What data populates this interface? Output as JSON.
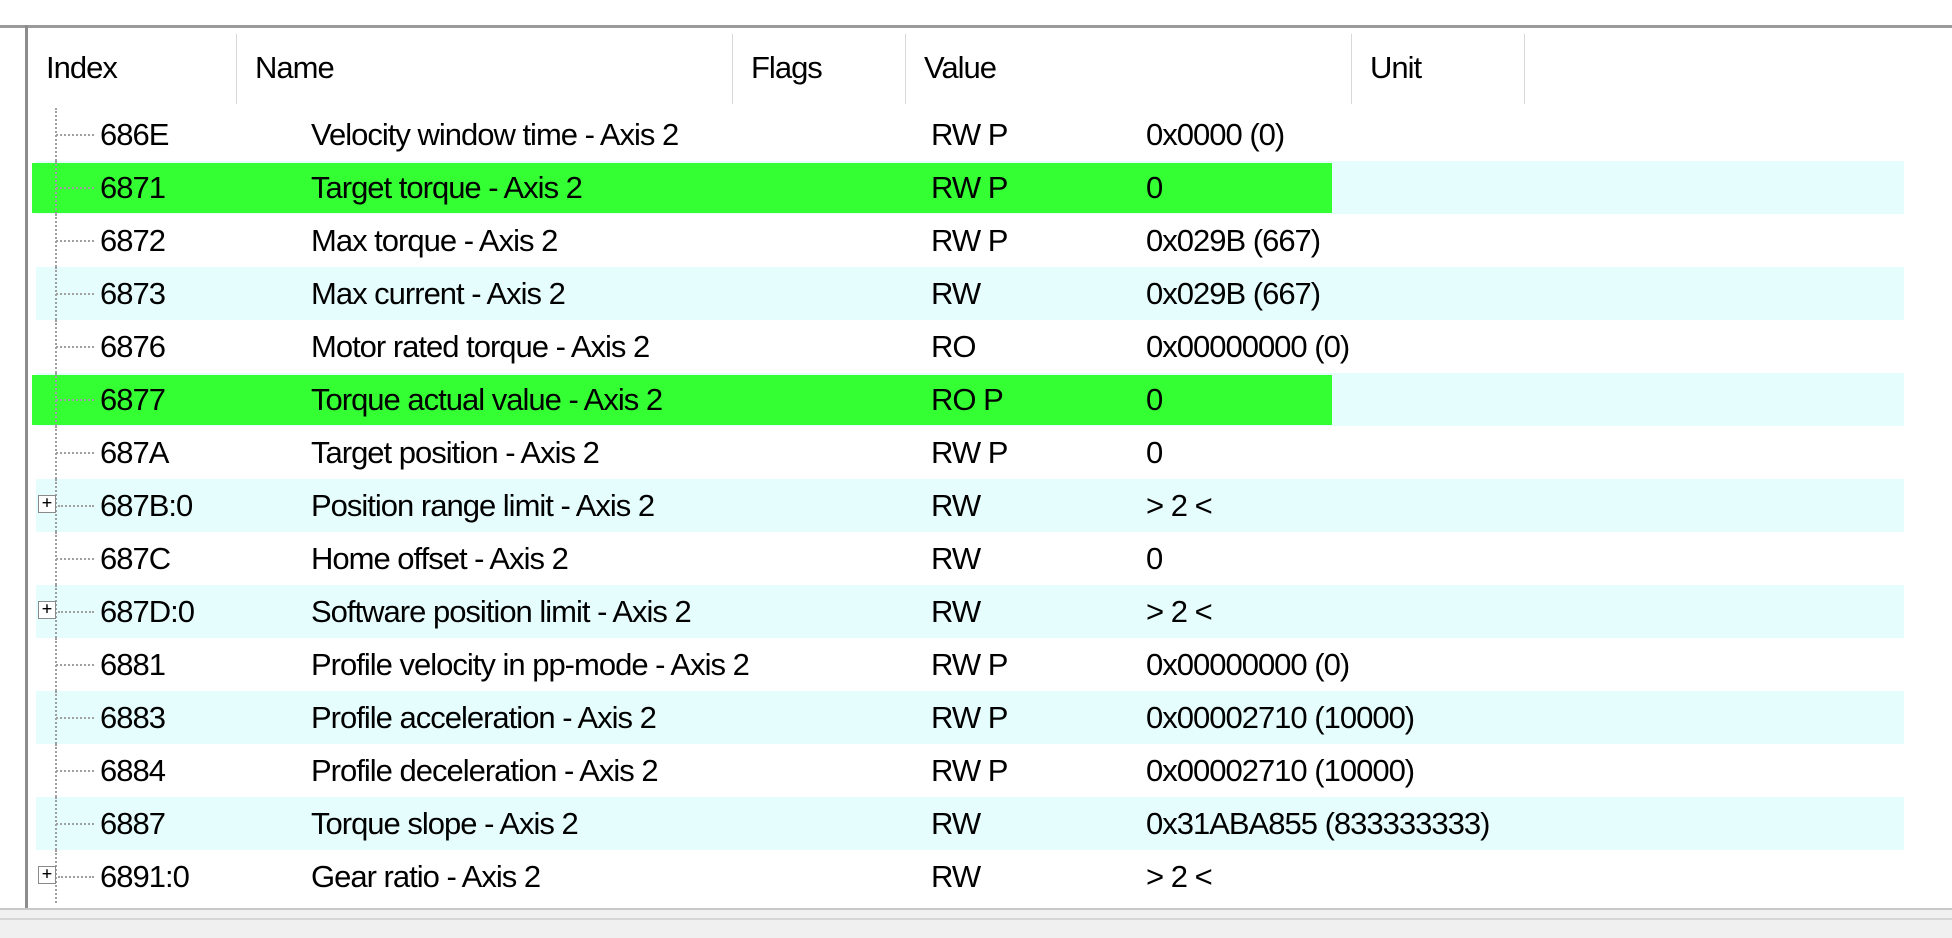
{
  "columns": {
    "index": "Index",
    "name": "Name",
    "flags": "Flags",
    "value": "Value",
    "unit": "Unit"
  },
  "rows": [
    {
      "index": "686E",
      "name": "Velocity window time - Axis 2",
      "flags": "RW P",
      "value": "0x0000 (0)",
      "highlighted": false,
      "expandable": false
    },
    {
      "index": "6871",
      "name": "Target torque - Axis 2",
      "flags": "RW P",
      "value": "0",
      "highlighted": true,
      "expandable": false
    },
    {
      "index": "6872",
      "name": "Max torque - Axis 2",
      "flags": "RW P",
      "value": "0x029B (667)",
      "highlighted": false,
      "expandable": false
    },
    {
      "index": "6873",
      "name": "Max current - Axis 2",
      "flags": "RW",
      "value": "0x029B (667)",
      "highlighted": false,
      "expandable": false
    },
    {
      "index": "6876",
      "name": "Motor rated torque - Axis 2",
      "flags": "RO",
      "value": "0x00000000 (0)",
      "highlighted": false,
      "expandable": false
    },
    {
      "index": "6877",
      "name": "Torque actual value - Axis 2",
      "flags": "RO P",
      "value": "0",
      "highlighted": true,
      "expandable": false
    },
    {
      "index": "687A",
      "name": "Target position - Axis 2",
      "flags": "RW P",
      "value": "0",
      "highlighted": false,
      "expandable": false
    },
    {
      "index": "687B:0",
      "name": "Position range limit - Axis 2",
      "flags": "RW",
      "value": "> 2 <",
      "highlighted": false,
      "expandable": true
    },
    {
      "index": "687C",
      "name": "Home offset - Axis 2",
      "flags": "RW",
      "value": "0",
      "highlighted": false,
      "expandable": false
    },
    {
      "index": "687D:0",
      "name": "Software position limit - Axis 2",
      "flags": "RW",
      "value": "> 2 <",
      "highlighted": false,
      "expandable": true
    },
    {
      "index": "6881",
      "name": "Profile velocity in pp-mode - Axis 2",
      "flags": "RW P",
      "value": "0x00000000 (0)",
      "highlighted": false,
      "expandable": false
    },
    {
      "index": "6883",
      "name": "Profile acceleration - Axis 2",
      "flags": "RW P",
      "value": "0x00002710 (10000)",
      "highlighted": false,
      "expandable": false
    },
    {
      "index": "6884",
      "name": "Profile deceleration - Axis 2",
      "flags": "RW P",
      "value": "0x00002710 (10000)",
      "highlighted": false,
      "expandable": false
    },
    {
      "index": "6887",
      "name": "Torque slope - Axis 2",
      "flags": "RW",
      "value": "0x31ABA855 (833333333)",
      "highlighted": false,
      "expandable": false
    },
    {
      "index": "6891:0",
      "name": "Gear ratio - Axis 2",
      "flags": "RW",
      "value": "> 2 <",
      "highlighted": false,
      "expandable": true
    }
  ],
  "expander_glyph": "+",
  "colors": {
    "highlight": "#33ff33",
    "alt_row": "#e6fdfd"
  }
}
